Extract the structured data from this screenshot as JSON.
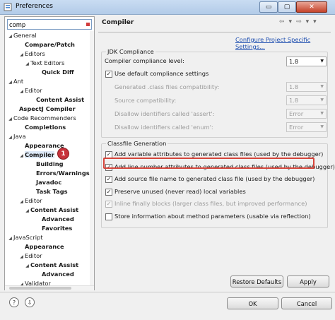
{
  "window": {
    "title": "Preferences",
    "min_glyph": "▭",
    "max_glyph": "▢",
    "close_glyph": "✕"
  },
  "filter": {
    "value": "comp"
  },
  "tree": [
    {
      "label": "General",
      "twisty": "◢",
      "indent": 0,
      "bold": false
    },
    {
      "label": "Compare/Patch",
      "twisty": "",
      "indent": 2,
      "bold": true
    },
    {
      "label": "Editors",
      "twisty": "◢",
      "indent": 2,
      "bold": false
    },
    {
      "label": "Text Editors",
      "twisty": "◢",
      "indent": 3,
      "bold": false
    },
    {
      "label": "Quick Diff",
      "twisty": "",
      "indent": 5,
      "bold": true
    },
    {
      "label": "Ant",
      "twisty": "◢",
      "indent": 0,
      "bold": false
    },
    {
      "label": "Editor",
      "twisty": "◢",
      "indent": 2,
      "bold": false
    },
    {
      "label": "Content Assist",
      "twisty": "",
      "indent": 4,
      "bold": true
    },
    {
      "label": "AspectJ Compiler",
      "twisty": "",
      "indent": 1,
      "bold": true
    },
    {
      "label": "Code Recommenders",
      "twisty": "◢",
      "indent": 0,
      "bold": false
    },
    {
      "label": "Completions",
      "twisty": "",
      "indent": 2,
      "bold": true
    },
    {
      "label": "Java",
      "twisty": "◢",
      "indent": 0,
      "bold": false
    },
    {
      "label": "Appearance",
      "twisty": "",
      "indent": 2,
      "bold": true
    },
    {
      "label": "Compiler",
      "twisty": "◢",
      "indent": 2,
      "bold": true,
      "selected": true
    },
    {
      "label": "Building",
      "twisty": "",
      "indent": 4,
      "bold": true
    },
    {
      "label": "Errors/Warnings",
      "twisty": "",
      "indent": 4,
      "bold": true
    },
    {
      "label": "Javadoc",
      "twisty": "",
      "indent": 4,
      "bold": true
    },
    {
      "label": "Task Tags",
      "twisty": "",
      "indent": 4,
      "bold": true
    },
    {
      "label": "Editor",
      "twisty": "◢",
      "indent": 2,
      "bold": false
    },
    {
      "label": "Content Assist",
      "twisty": "◢",
      "indent": 3,
      "bold": true
    },
    {
      "label": "Advanced",
      "twisty": "",
      "indent": 5,
      "bold": true
    },
    {
      "label": "Favorites",
      "twisty": "",
      "indent": 5,
      "bold": true
    },
    {
      "label": "JavaScript",
      "twisty": "◢",
      "indent": 0,
      "bold": false
    },
    {
      "label": "Appearance",
      "twisty": "",
      "indent": 2,
      "bold": true
    },
    {
      "label": "Editor",
      "twisty": "◢",
      "indent": 2,
      "bold": false
    },
    {
      "label": "Content Assist",
      "twisty": "◢",
      "indent": 3,
      "bold": true
    },
    {
      "label": "Advanced",
      "twisty": "",
      "indent": 5,
      "bold": true
    },
    {
      "label": "Validator",
      "twisty": "◢",
      "indent": 2,
      "bold": false
    }
  ],
  "badge": "1",
  "page": {
    "title": "Compiler",
    "configure_link": "Configure Project Specific Settings...",
    "nav_back": "⇦",
    "nav_forward": "⇨",
    "nav_menu": "▾"
  },
  "jdk": {
    "group_label": "JDK Compliance",
    "compliance_label": "Compiler compliance level:",
    "compliance_value": "1.8",
    "use_default_label": "Use default compliance settings",
    "use_default_checked": true,
    "generated_label": "Generated .class files compatibility:",
    "generated_value": "1.8",
    "source_label": "Source compatibility:",
    "source_value": "1.8",
    "assert_label": "Disallow identifiers called 'assert':",
    "assert_value": "Error",
    "enum_label": "Disallow identifiers called 'enum':",
    "enum_value": "Error"
  },
  "classfile": {
    "group_label": "Classfile Generation",
    "options": [
      {
        "label": "Add variable attributes to generated class files (used by the debugger)",
        "checked": true,
        "disabled": false
      },
      {
        "label": "Add line number attributes to generated class files (used by the debugger)",
        "checked": true,
        "disabled": false
      },
      {
        "label": "Add source file name to generated class file (used by the debugger)",
        "checked": true,
        "disabled": false
      },
      {
        "label": "Preserve unused (never read) local variables",
        "checked": true,
        "disabled": false
      },
      {
        "label": "Inline finally blocks (larger class files, but improved performance)",
        "checked": true,
        "disabled": true
      },
      {
        "label": "Store information about method parameters (usable via reflection)",
        "checked": false,
        "disabled": false
      }
    ]
  },
  "buttons": {
    "restore": "Restore Defaults",
    "apply": "Apply",
    "ok": "OK",
    "cancel": "Cancel"
  },
  "help": {
    "help_glyph": "?",
    "import_glyph": "⇩"
  },
  "colors": {
    "highlight": "#d6453b",
    "link": "#1f4fb0",
    "badge": "#c8323b"
  }
}
